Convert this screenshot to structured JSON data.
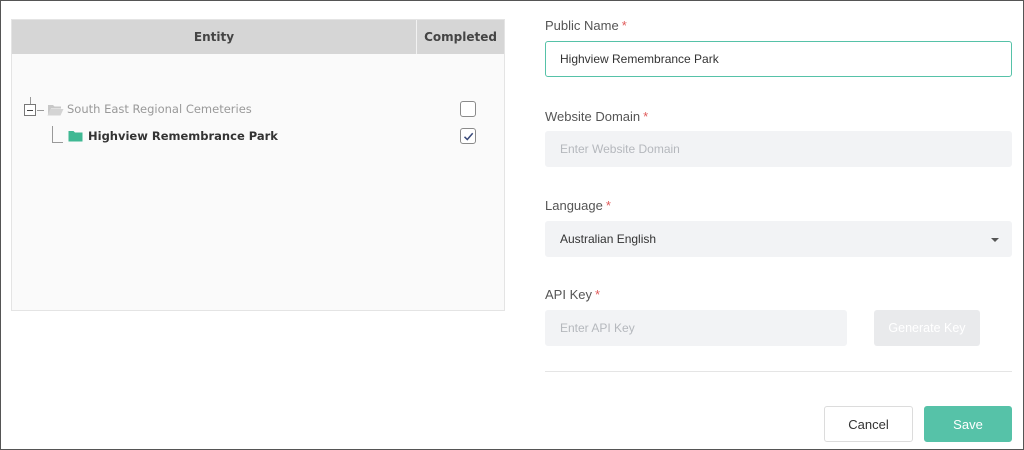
{
  "tree": {
    "columns": {
      "entity": "Entity",
      "completed": "Completed"
    },
    "rows": [
      {
        "label": "South East Regional Cemeteries",
        "icon": "folder-open-icon",
        "expanded": true,
        "completed": false
      },
      {
        "label": "Highview Remembrance Park",
        "icon": "folder-icon",
        "completed": true
      }
    ]
  },
  "form": {
    "public_name": {
      "label": "Public Name",
      "required_mark": "*",
      "value": "Highview Remembrance Park"
    },
    "website_domain": {
      "label": "Website Domain",
      "required_mark": "*",
      "placeholder": "Enter Website Domain"
    },
    "language": {
      "label": "Language",
      "required_mark": "*",
      "value": "Australian English"
    },
    "api_key": {
      "label": "API Key",
      "required_mark": "*",
      "placeholder": "Enter API Key",
      "generate_label": "Generate Key"
    }
  },
  "actions": {
    "cancel_label": "Cancel",
    "save_label": "Save"
  },
  "colors": {
    "accent": "#56c2a8",
    "required": "#e05a5a",
    "header_bg": "#d6d6d6",
    "input_bg": "#f2f3f5"
  }
}
